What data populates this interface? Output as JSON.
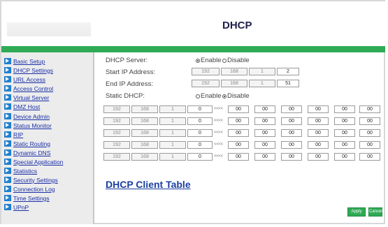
{
  "header": {
    "title": "DHCP"
  },
  "sidebar": {
    "items": [
      {
        "label": "Basic Setup"
      },
      {
        "label": "DHCP Settings"
      },
      {
        "label": "URL Access"
      },
      {
        "label": "Access Control"
      },
      {
        "label": "Virtual Server"
      },
      {
        "label": "DMZ Host"
      },
      {
        "label": "Device Admin"
      },
      {
        "label": "Status Monitor"
      },
      {
        "label": "RIP"
      },
      {
        "label": "Static Routing"
      },
      {
        "label": "Dynamic DNS"
      },
      {
        "label": "Special Application"
      },
      {
        "label": "Statistics"
      },
      {
        "label": "Security Settings"
      },
      {
        "label": "Connection Log"
      },
      {
        "label": "Time Settings"
      },
      {
        "label": "UPnP"
      }
    ]
  },
  "form": {
    "dhcp_server_label": "DHCP Server:",
    "enable_label": "Enable",
    "disable_label": "Disable",
    "dhcp_server_value": "Enable",
    "start_ip_label": "Start IP Address:",
    "start_ip": [
      "192",
      "168",
      "1",
      "2"
    ],
    "end_ip_label": "End IP Address:",
    "end_ip": [
      "192",
      "168",
      "1",
      "51"
    ],
    "static_dhcp_label": "Static DHCP:",
    "static_dhcp_value": "Disable",
    "static_rows": [
      {
        "ip": [
          "192",
          "168",
          "1",
          "0"
        ],
        "arrows": "<<<<",
        "mac": [
          "00",
          "00",
          "00",
          "00",
          "00",
          "00"
        ]
      },
      {
        "ip": [
          "192",
          "168",
          "1",
          "0"
        ],
        "arrows": "<<<<",
        "mac": [
          "00",
          "00",
          "00",
          "00",
          "00",
          "00"
        ]
      },
      {
        "ip": [
          "192",
          "168",
          "1",
          "0"
        ],
        "arrows": "<<<<",
        "mac": [
          "00",
          "00",
          "00",
          "00",
          "00",
          "00"
        ]
      },
      {
        "ip": [
          "192",
          "168",
          "1",
          "0"
        ],
        "arrows": "<<<<",
        "mac": [
          "00",
          "00",
          "00",
          "00",
          "00",
          "00"
        ]
      },
      {
        "ip": [
          "192",
          "168",
          "1",
          "0"
        ],
        "arrows": "<<<<",
        "mac": [
          "00",
          "00",
          "00",
          "00",
          "00",
          "00"
        ]
      }
    ]
  },
  "client_table_link": "DHCP Client Table",
  "buttons": {
    "apply": "Apply",
    "cancel": "Cancel"
  },
  "colors": {
    "accent_green": "#2faa55",
    "link_blue": "#1a2fa8",
    "arrow_blue": "#1f7fd0"
  }
}
